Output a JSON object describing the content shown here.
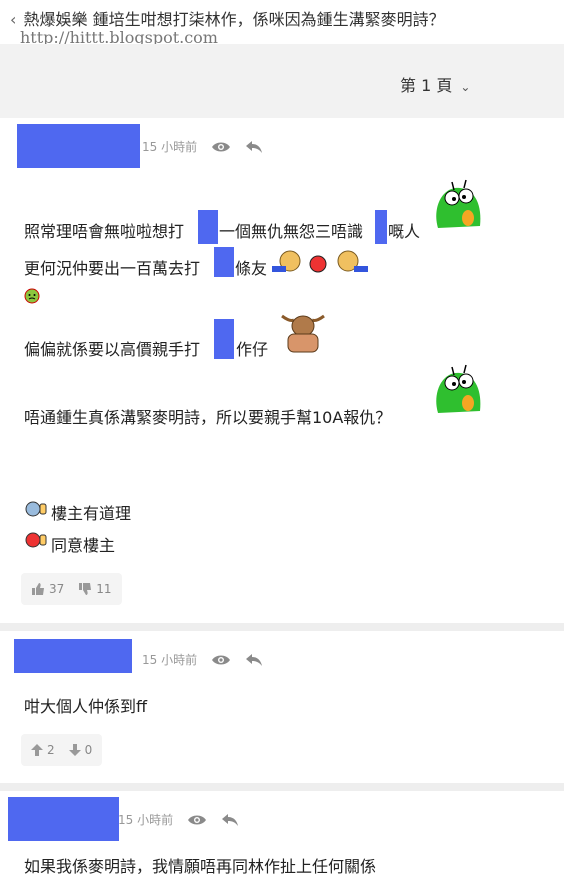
{
  "header": {
    "back_glyph": "‹",
    "title": "熱爆娛樂 鍾培生咁想打柒林作，係咪因為鍾生溝緊麥明詩？",
    "watermark": "http://hittt.blogspot.com"
  },
  "pager": {
    "label": "第 1 頁"
  },
  "posts": [
    {
      "time": "15 小時前",
      "lines": [
        "照常理唔會無啦啦想打",
        "一個無仇無怨三唔識",
        "嘅人",
        "更何況仲要出一百萬去打",
        "條友",
        "偏偏就係要以高價親手打",
        "作仔",
        "唔通鍾生真係溝緊麥明詩，所以要親手幫10A報仇？",
        "樓主有道理",
        "同意樓主"
      ],
      "likes": "37",
      "dislikes": "11"
    },
    {
      "time": "15 小時前",
      "lines": [
        "咁大個人仲係到ff"
      ],
      "likes": "2",
      "dislikes": "0"
    },
    {
      "time": "15 小時前",
      "lines": [
        "如果我係麥明詩，我情願唔再同林作扯上任何關係"
      ]
    }
  ],
  "colors": {
    "redaction": "#4f68f0",
    "accent_green": "#2fbf2f"
  }
}
